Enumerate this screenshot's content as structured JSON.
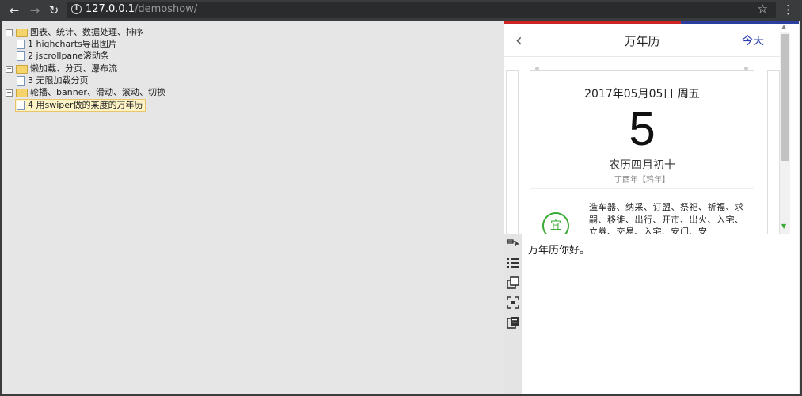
{
  "browser": {
    "url_host": "127.0.0.1",
    "url_path": "/demoshow/",
    "icons": [
      "back-arrow-icon",
      "forward-arrow-icon",
      "reload-icon",
      "info-icon",
      "star-icon",
      "menu-dots-icon"
    ]
  },
  "tree": {
    "nodes": [
      {
        "type": "folder",
        "label": "图表、统计、数据处理、排序",
        "toggle": "⊟"
      },
      {
        "type": "file",
        "label": "1 highcharts导出图片"
      },
      {
        "type": "file",
        "label": "2 jscrollpane滚动条"
      },
      {
        "type": "folder",
        "label": "懒加载、分页、瀑布流",
        "toggle": "⊟"
      },
      {
        "type": "file",
        "label": "3 无限加载分页"
      },
      {
        "type": "folder",
        "label": "轮播、banner、滑动、滚动、切换",
        "toggle": "⊟"
      },
      {
        "type": "file",
        "label": "4 用swiper做的某度的万年历",
        "selected": true
      }
    ]
  },
  "preview": {
    "back_glyph": "‹",
    "title": "万年历",
    "today_button": "今天",
    "date_line": "2017年05月05日 周五",
    "day_number": "5",
    "lunar": "农历四月初十",
    "ganzhi": "丁酉年【鸡年】",
    "yi_badge": "宜",
    "yi_text": "造车器、纳采、订盟、祭祀、祈福、求嗣、移徙、出行、开市、出火、入宅、立券、交易、入宅、安门、安"
  },
  "tools": {
    "icons": [
      "pin-icon",
      "list-icon",
      "windows-icon",
      "capture-icon",
      "clipboard-icon"
    ]
  },
  "output": {
    "text": "万年历你好。"
  },
  "colors": {
    "accent_red": "#d02424",
    "accent_blue": "#2c3fb1",
    "yi_green": "#3aaa35"
  }
}
